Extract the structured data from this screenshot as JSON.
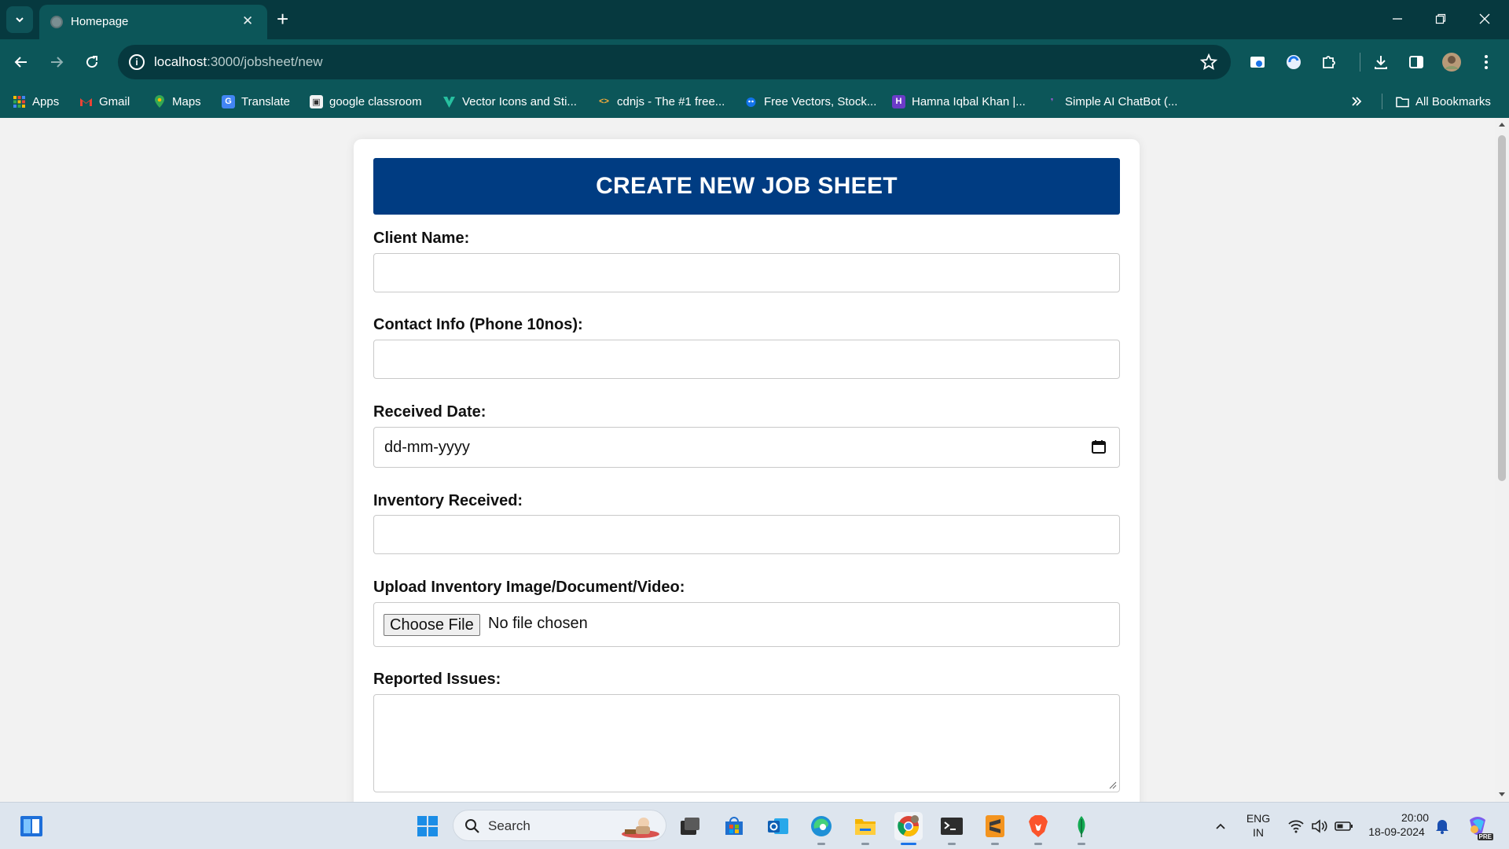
{
  "browser": {
    "tab_title": "Homepage",
    "url_host": "localhost",
    "url_path": ":3000/jobsheet/new",
    "bookmarks": [
      {
        "label": "Apps",
        "icon": "apps-grid-icon"
      },
      {
        "label": "Gmail",
        "icon": "gmail-icon"
      },
      {
        "label": "Maps",
        "icon": "maps-icon"
      },
      {
        "label": "Translate",
        "icon": "translate-icon"
      },
      {
        "label": "google classroom",
        "icon": "classroom-icon"
      },
      {
        "label": "Vector Icons and Sti...",
        "icon": "vector-icons-icon"
      },
      {
        "label": "cdnjs - The #1 free...",
        "icon": "code-icon"
      },
      {
        "label": "Free Vectors, Stock...",
        "icon": "freepik-icon"
      },
      {
        "label": "Hamna Iqbal Khan |...",
        "icon": "hashnode-icon"
      },
      {
        "label": "Simple AI ChatBot (...",
        "icon": "chatbot-icon"
      }
    ],
    "all_bookmarks_label": "All Bookmarks"
  },
  "form": {
    "title": "CREATE NEW JOB SHEET",
    "client_name_label": "Client Name:",
    "contact_label": "Contact Info (Phone 10nos):",
    "received_date_label": "Received Date:",
    "date_placeholder": "dd-mm-yyyy",
    "inventory_label": "Inventory Received:",
    "upload_label": "Upload Inventory Image/Document/Video:",
    "choose_file_label": "Choose File",
    "no_file_text": "No file chosen",
    "reported_issues_label": "Reported Issues:"
  },
  "taskbar": {
    "search_label": "Search",
    "lang_top": "ENG",
    "lang_bottom": "IN",
    "time": "20:00",
    "date": "18-09-2024",
    "pre_badge": "PRE"
  },
  "colors": {
    "chrome_dark": "#06393f",
    "chrome_toolbar": "#0c5659",
    "form_header": "#003c82",
    "page_bg": "#f2f2f2"
  }
}
